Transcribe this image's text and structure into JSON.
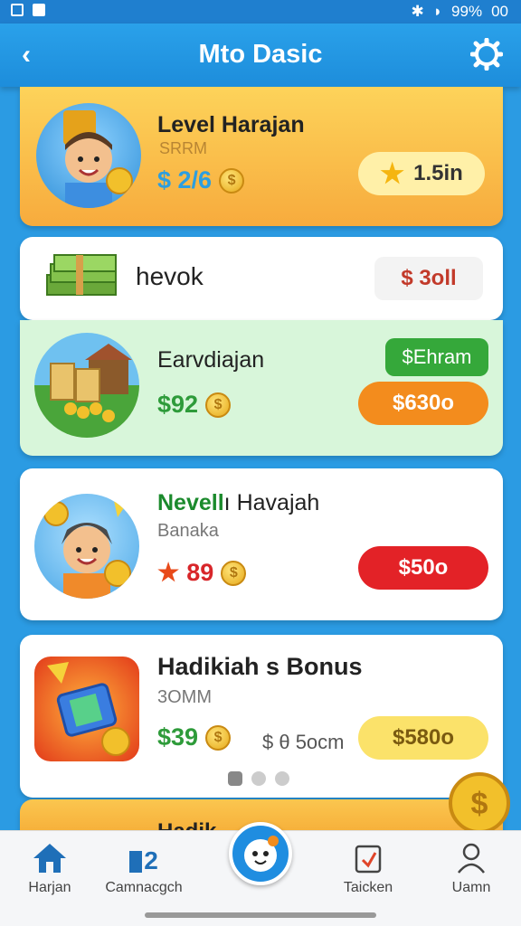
{
  "status": {
    "battery": "99%",
    "time": "00"
  },
  "header": {
    "title": "Mto Dasic"
  },
  "cards": [
    {
      "name": "Level Harajan",
      "sub": "SRRM",
      "value": "$ 2/6",
      "pill": "1.5in",
      "pill_color": "#fff0a8"
    },
    {
      "name": "hevok",
      "pill": "$ 3oll"
    },
    {
      "name": "Earvdiajan",
      "value": "$92",
      "badge": "$Ehram",
      "pill": "$630o"
    },
    {
      "name_prefix": "Nevell",
      "name": "Havajah",
      "sub": "Banaka",
      "value": "89",
      "pill": "$50o"
    },
    {
      "name": "Hadikiah s Bonus",
      "sub": "3OMM",
      "value": "$39",
      "extra": "$ θ 5ocm",
      "pill": "$580o"
    },
    {
      "name": "Hadik"
    }
  ],
  "nav": [
    {
      "label": "Harjan",
      "icon": "home-icon"
    },
    {
      "label": "Camnacgch",
      "icon": "chart-icon"
    },
    {
      "label": "",
      "icon": "face-icon"
    },
    {
      "label": "Taicken",
      "icon": "ticket-icon"
    },
    {
      "label": "Uamn",
      "icon": "user-icon"
    }
  ]
}
